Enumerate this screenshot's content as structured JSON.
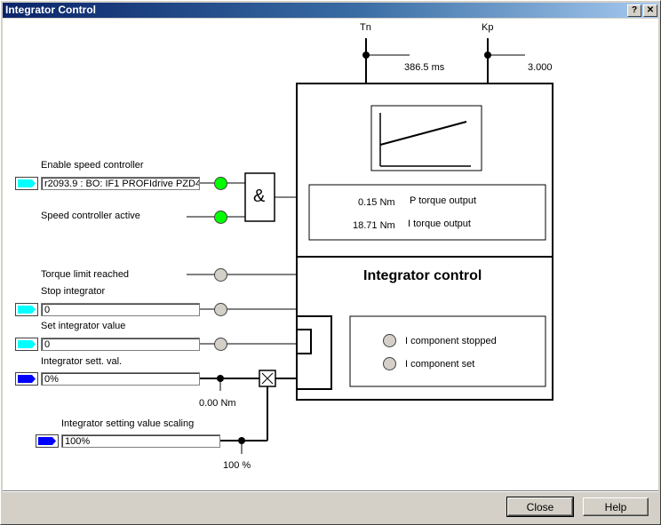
{
  "window": {
    "title": "Integrator Control",
    "help_glyph": "?",
    "close_glyph": "✕"
  },
  "params": {
    "tn_label": "Tn",
    "tn_value": "386.5 ms",
    "kp_label": "Kp",
    "kp_value": "3.000"
  },
  "outputs": {
    "p_value": "0.15 Nm",
    "p_label": "P torque output",
    "i_value": "18.71 Nm",
    "i_label": "I torque output"
  },
  "block_title": "Integrator control",
  "status": {
    "stopped_label": "I component stopped",
    "set_label": "I component set"
  },
  "inputs": {
    "enable_label": "Enable speed controller",
    "enable_value": "r2093.9 : BO: IF1 PROFIdrive PZD4",
    "active_label": "Speed controller active",
    "and_symbol": "&",
    "torque_limit_label": "Torque limit reached",
    "stop_label": "Stop integrator",
    "stop_value": "0",
    "set_label": "Set integrator value",
    "set_value": "0",
    "sett_val_label": "Integrator sett. val.",
    "sett_val_value": "0%",
    "sett_val_readout": "0.00 Nm",
    "scaling_label": "Integrator setting value scaling",
    "scaling_value": "100%",
    "scaling_readout": "100 %"
  },
  "buttons": {
    "close": "Close",
    "help": "Help"
  },
  "colors": {
    "connector_cyan": "#00ffff",
    "connector_blue": "#0000ff",
    "led_on": "#00ff00",
    "led_off": "#d4d0c8"
  }
}
